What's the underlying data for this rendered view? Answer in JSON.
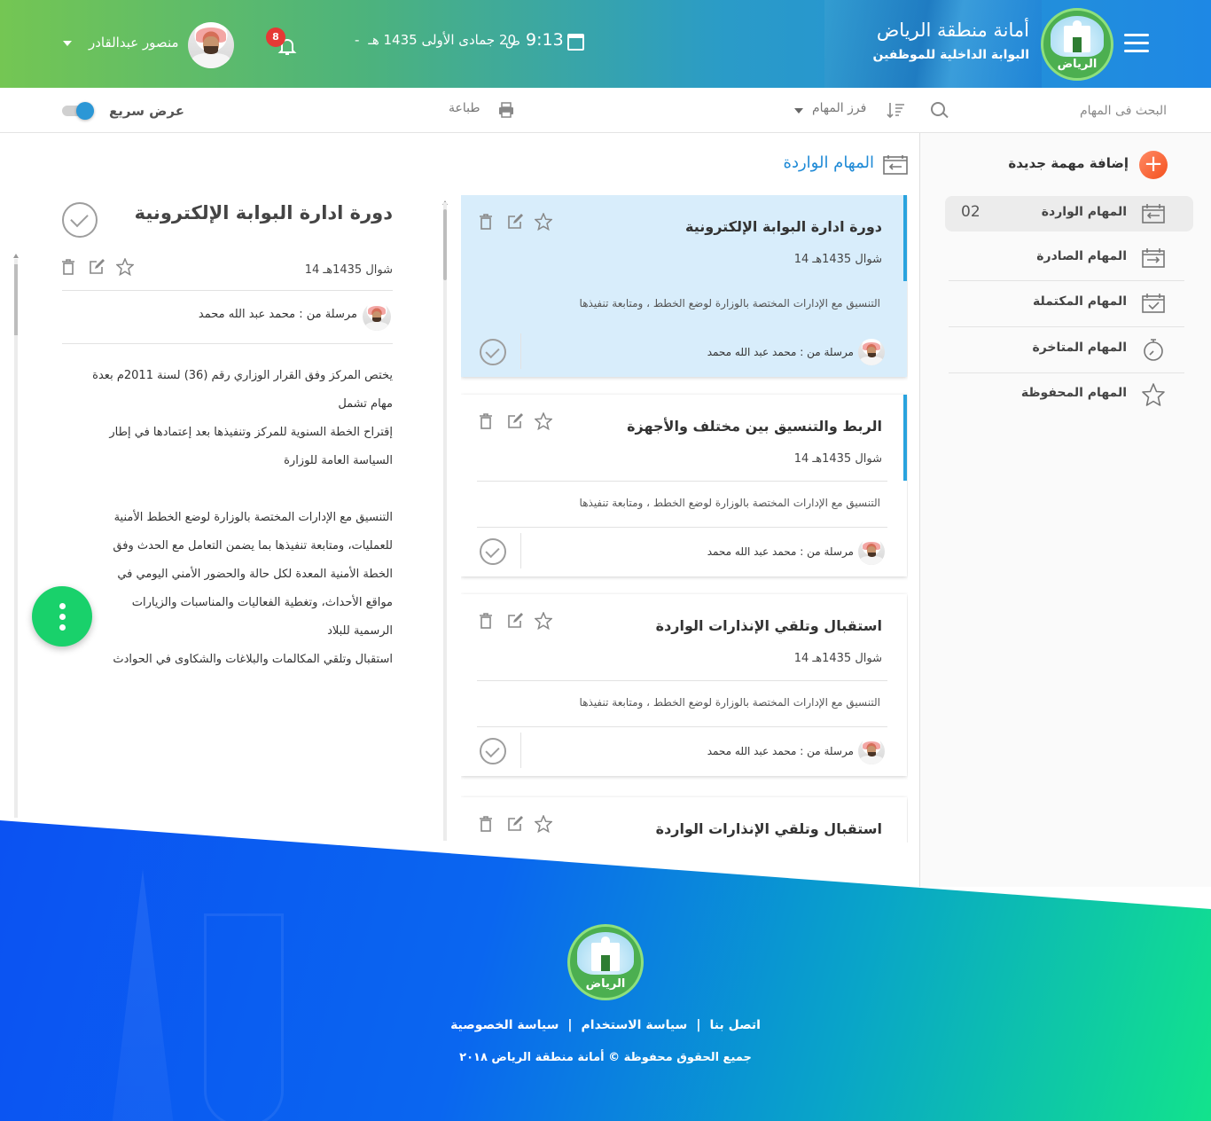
{
  "header": {
    "title": "أمانة منطقة الرياض",
    "subtitle": "البوابة الداخلية للموظفين",
    "logo_text": "الرياض",
    "time": "9:13",
    "time_suffix": "ص",
    "date_sep": "-",
    "date": "20 جمادى الأولى 1435 هـ",
    "notifications_count": "8",
    "user_name": "منصور عبدالقادر"
  },
  "toolbar": {
    "search_placeholder": "البحث فى المهام",
    "sort_label": "فرز المهام",
    "print_label": "طباعة",
    "quick_view_label": "عرض سريع",
    "quick_view_on": true
  },
  "sidebar": {
    "add_label": "إضافة مهمة جديدة",
    "items": [
      {
        "label": "المهام الواردة",
        "count": "02",
        "icon": "inbox-tray-icon"
      },
      {
        "label": "المهام الصادرة",
        "count": "",
        "icon": "outbox-tray-icon"
      },
      {
        "label": "المهام المكتملة",
        "count": "",
        "icon": "calendar-check-icon"
      },
      {
        "label": "المهام المتاخرة",
        "count": "",
        "icon": "stopwatch-icon"
      },
      {
        "label": "المهام المحفوظة",
        "count": "",
        "icon": "star-icon"
      }
    ]
  },
  "list": {
    "heading": "المهام الواردة",
    "cards": [
      {
        "title": "دورة ادارة البوابة الإلكترونية",
        "date": "شوال 1435هـ 14",
        "desc": "التنسيق مع الإدارات المختصة بالوزارة لوضع الخطط ، ومتابعة تنفيذها",
        "sender": "مرسلة من : محمد عبد الله محمد"
      },
      {
        "title": "الربط والتنسيق بين مختلف  والأجهزة",
        "date": "شوال 1435هـ 14",
        "desc": "التنسيق مع الإدارات المختصة بالوزارة لوضع الخطط ، ومتابعة تنفيذها",
        "sender": "مرسلة من : محمد عبد الله محمد"
      },
      {
        "title": "استقبال وتلقي الإنذارات الواردة",
        "date": "شوال 1435هـ 14",
        "desc": "التنسيق مع الإدارات المختصة بالوزارة لوضع الخطط ، ومتابعة تنفيذها",
        "sender": "مرسلة من : محمد عبد الله محمد"
      },
      {
        "title": "استقبال وتلقي الإنذارات الواردة",
        "date": "",
        "desc": "",
        "sender": ""
      }
    ]
  },
  "detail": {
    "title": "دورة ادارة البوابة الإلكترونية",
    "date": "شوال 1435هـ 14",
    "sender": "مرسلة من : محمد عبد الله محمد",
    "body": [
      "يختص المركز وفق القرار الوزاري رقم (36) لسنة 2011م بعدة",
      "مهام تشمل",
      "إقتراح الخطة السنوية للمركز وتنفيذها بعد إعتمادها في إطار",
      "السياسة العامة للوزارة",
      "",
      "التنسيق مع الإدارات المختصة بالوزارة لوضع الخطط الأمنية",
      "للعمليات، ومتابعة تنفيذها بما يضمن التعامل مع الحدث وفق",
      "الخطة الأمنية المعدة لكل حالة والحضور الأمني اليومي في",
      "مواقع الأحداث، وتغطية الفعاليات والمناسبات والزيارات",
      "الرسمية للبلاد",
      "استقبال وتلقي المكالمات والبلاغات والشكاوى في الحوادث"
    ]
  },
  "footer": {
    "logo_text": "الرياض",
    "links": [
      "اتصل بنا",
      "سياسة الاستخدام",
      "سياسة الخصوصية"
    ],
    "separator": "|",
    "copyright": "جميع الحقوق محفوظة © أمانة منطقة الرياض ٢٠١٨"
  },
  "colors": {
    "accent": "#1f8ad6",
    "active_card": "#d8edfb",
    "fab": "#19d16b",
    "add_button": "#f4511e",
    "badge": "#e53935"
  }
}
